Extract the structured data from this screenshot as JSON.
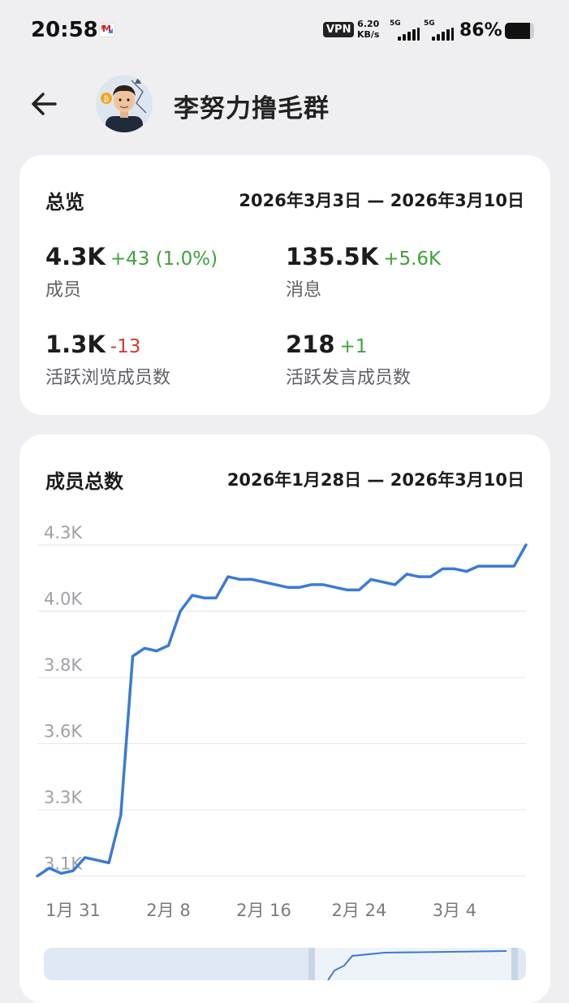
{
  "status_bar": {
    "time": "20:58",
    "vpn": "VPN",
    "speed_value": "6.20",
    "speed_unit": "KB/s",
    "sim1": "5G",
    "sim2": "5G",
    "battery_text": "86%",
    "battery_level": 0.86
  },
  "header": {
    "title": "李努力撸毛群",
    "back_icon": "arrow-left-icon"
  },
  "overview": {
    "title": "总览",
    "range": "2026年3月3日 — 2026年3月10日",
    "stats": [
      {
        "value": "4.3K",
        "delta": "+43 (1.0%)",
        "trend": "up",
        "label": "成员"
      },
      {
        "value": "135.5K",
        "delta": "+5.6K",
        "trend": "up",
        "label": "消息"
      },
      {
        "value": "1.3K",
        "delta": "-13",
        "trend": "down",
        "label": "活跃浏览成员数"
      },
      {
        "value": "218",
        "delta": "+1",
        "trend": "up",
        "label": "活跃发言成员数"
      }
    ]
  },
  "members_chart": {
    "title": "成员总数",
    "range": "2026年1月28日 — 2026年3月10日"
  },
  "chart_data": {
    "type": "line",
    "title": "成员总数",
    "yticks": [
      "4.3K",
      "4.0K",
      "3.8K",
      "3.6K",
      "3.3K",
      "3.1K"
    ],
    "ytick_values": [
      4300,
      4050,
      3800,
      3550,
      3300,
      3050
    ],
    "ylim": [
      3000,
      4300
    ],
    "xticks": [
      "1月 31",
      "2月 8",
      "2月 16",
      "2月 24",
      "3月 4"
    ],
    "xtick_days": [
      3,
      11,
      19,
      27,
      35
    ],
    "x_days": [
      0,
      1,
      2,
      3,
      4,
      5,
      6,
      7,
      8,
      9,
      10,
      11,
      12,
      13,
      14,
      15,
      16,
      17,
      18,
      19,
      20,
      21,
      22,
      23,
      24,
      25,
      26,
      27,
      28,
      29,
      30,
      31,
      32,
      33,
      34,
      35,
      36,
      37,
      38,
      39,
      40,
      41
    ],
    "values": [
      3050,
      3080,
      3060,
      3070,
      3120,
      3110,
      3100,
      3280,
      3880,
      3910,
      3900,
      3920,
      4050,
      4110,
      4100,
      4100,
      4180,
      4170,
      4170,
      4160,
      4150,
      4140,
      4140,
      4150,
      4150,
      4140,
      4130,
      4130,
      4170,
      4160,
      4150,
      4190,
      4180,
      4180,
      4210,
      4210,
      4200,
      4220,
      4220,
      4220,
      4220,
      4300
    ],
    "color": "#3a7bd5",
    "grid": true
  }
}
